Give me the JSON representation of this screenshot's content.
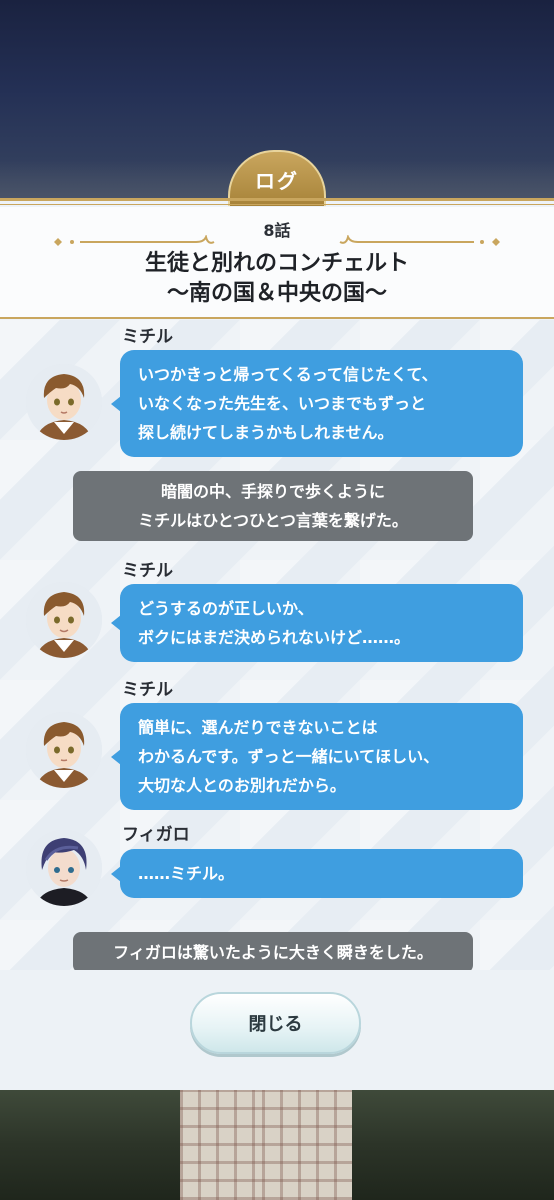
{
  "dialog": {
    "tab_label": "ログ",
    "episode": "8話",
    "title_line1": "生徒と別れのコンチェルト",
    "title_line2": "〜南の国＆中央の国〜",
    "close_label": "閉じる"
  },
  "log": [
    {
      "type": "speech",
      "speaker": "ミチル",
      "lines": [
        "いつかきっと帰ってくるって信じたくて、",
        "いなくなった先生を、いつまでもずっと",
        "探し続けてしまうかもしれません。"
      ]
    },
    {
      "type": "narration",
      "lines": [
        "暗闇の中、手探りで歩くように",
        "ミチルはひとつひとつ言葉を繋げた。"
      ]
    },
    {
      "type": "speech",
      "speaker": "ミチル",
      "lines": [
        "どうするのが正しいか、",
        "ボクにはまだ決められないけど……。"
      ]
    },
    {
      "type": "speech",
      "speaker": "ミチル",
      "lines": [
        "簡単に、選んだりできないことは",
        "わかるんです。ずっと一緒にいてほしい、",
        "大切な人とのお別れだから。"
      ]
    },
    {
      "type": "speech",
      "speaker": "フィガロ",
      "lines": [
        "……ミチル。"
      ]
    },
    {
      "type": "narration",
      "lines": [
        "フィガロは驚いたように大きく瞬きをした。"
      ]
    }
  ],
  "colors": {
    "bubble": "#3f9ee0",
    "narration": "#6e7377",
    "gold": "#c9a65e"
  },
  "icons": {
    "michiru": "michiru-avatar",
    "figaro": "figaro-avatar"
  }
}
